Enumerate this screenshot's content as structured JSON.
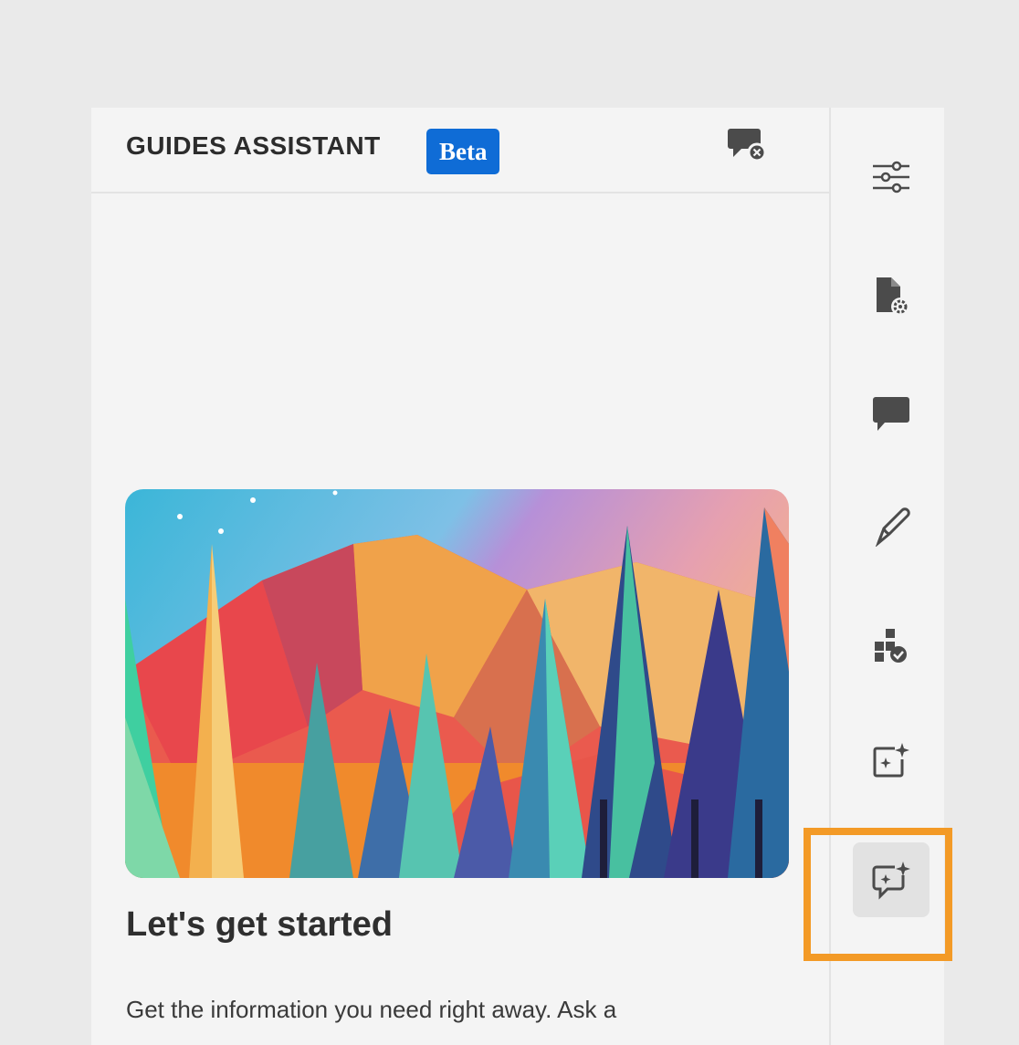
{
  "panel": {
    "title": "GUIDES ASSISTANT",
    "badge": "Beta",
    "header_action_icon": "end-chat-icon"
  },
  "content": {
    "heading": "Let's get started",
    "body": "Get the information you need right away. Ask a"
  },
  "rail": {
    "items": [
      {
        "name": "filters-icon"
      },
      {
        "name": "document-settings-icon"
      },
      {
        "name": "comment-icon"
      },
      {
        "name": "edit-pen-icon"
      },
      {
        "name": "approve-blocks-icon"
      },
      {
        "name": "ai-content-icon"
      },
      {
        "name": "ai-chat-icon",
        "active": true
      }
    ]
  },
  "colors": {
    "accent_blue": "#0f6cd6",
    "highlight_orange": "#f39a26",
    "icon_gray": "#4b4b4b"
  }
}
